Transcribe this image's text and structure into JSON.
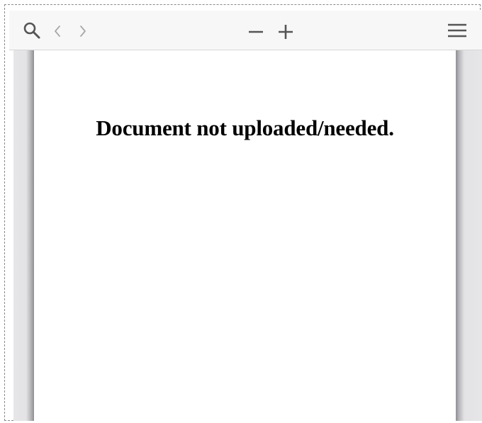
{
  "toolbar": {
    "search_icon": "search-icon",
    "prev_icon": "chevron-left-icon",
    "next_icon": "chevron-right-icon",
    "zoom_out_icon": "minus-icon",
    "zoom_in_icon": "plus-icon",
    "menu_icon": "hamburger-menu-icon"
  },
  "document": {
    "message": "Document not uploaded/needed."
  },
  "colors": {
    "toolbar_bg": "#f7f7f7",
    "icon_active": "#555555",
    "icon_disabled": "#a8a8a8",
    "page_bg": "#ffffff",
    "text": "#000000"
  }
}
